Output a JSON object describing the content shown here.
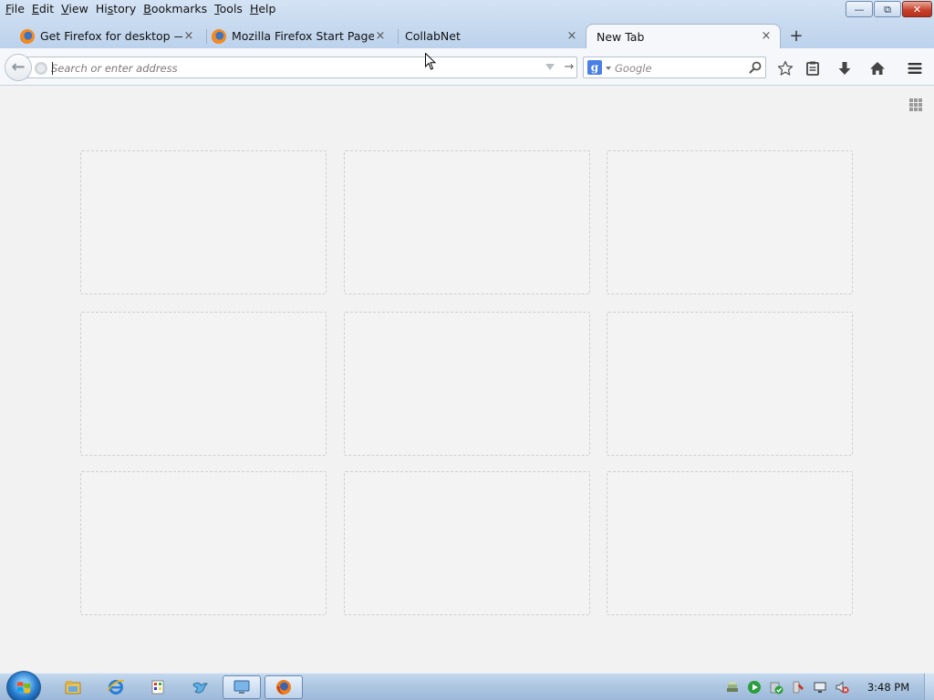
{
  "menu": [
    "File",
    "Edit",
    "View",
    "History",
    "Bookmarks",
    "Tools",
    "Help"
  ],
  "menu_access_keys": [
    "F",
    "E",
    "V",
    "s",
    "B",
    "T",
    "H"
  ],
  "window_controls": {
    "minimize": "—",
    "maximize": "⧉",
    "close": "✕"
  },
  "tabs": [
    {
      "label": "Get Firefox for desktop — ...",
      "has_favicon": true,
      "selected": false
    },
    {
      "label": "Mozilla Firefox Start Page",
      "has_favicon": true,
      "selected": false
    },
    {
      "label": "CollabNet",
      "has_favicon": false,
      "selected": false
    },
    {
      "label": "New Tab",
      "has_favicon": false,
      "selected": true
    }
  ],
  "tab_close_glyph": "×",
  "new_tab_glyph": "+",
  "navbar": {
    "back_glyph": "←",
    "address_placeholder": "Search or enter address",
    "address_value": "",
    "go_glyph": "→",
    "search_engine_letter": "g",
    "search_placeholder": "Google"
  },
  "toolbar_icons": [
    "bookmark-star-icon",
    "reading-list-icon",
    "downloads-icon",
    "home-icon",
    "menu-icon"
  ],
  "new_tab_page": {
    "tiles": [
      {
        "row": 0,
        "col": 0
      },
      {
        "row": 0,
        "col": 1
      },
      {
        "row": 0,
        "col": 2
      },
      {
        "row": 1,
        "col": 0
      },
      {
        "row": 1,
        "col": 1
      },
      {
        "row": 1,
        "col": 2
      },
      {
        "row": 2,
        "col": 0
      },
      {
        "row": 2,
        "col": 1
      },
      {
        "row": 2,
        "col": 2
      }
    ]
  },
  "taskbar": {
    "pinned": [
      "explorer-icon",
      "internet-explorer-icon",
      "paint-icon",
      "bird-app-icon",
      "remote-desktop-icon",
      "firefox-icon"
    ],
    "tray": [
      "network-stack-icon",
      "media-player-icon",
      "security-check-icon",
      "tool-icon",
      "display-icon",
      "volume-muted-icon"
    ],
    "clock": "3:48 PM"
  },
  "colors": {
    "titlebar": "#c5d8ee",
    "content_bg": "#f2f2f2",
    "close_button": "#c7432e",
    "tile_border": "#cfcfcf",
    "taskbar": "#aec7e2"
  }
}
